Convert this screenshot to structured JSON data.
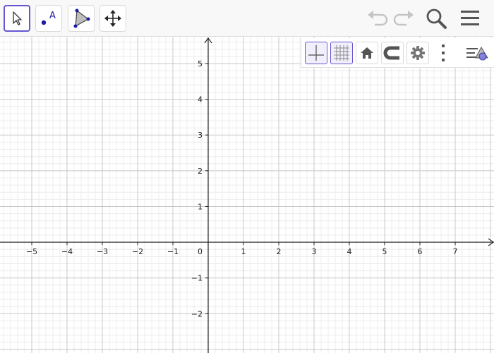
{
  "colors": {
    "accent": "#6557d2",
    "axis": "#222222",
    "grid_major": "#c8c8c8",
    "grid_minor": "#ececec",
    "icon": "#555555",
    "icon_disabled": "#c4c4c4",
    "point": "#1a1aa8"
  },
  "toolbar": {
    "tools": [
      {
        "name": "move-tool",
        "icon": "cursor-arrow-icon",
        "active": true
      },
      {
        "name": "point-tool",
        "icon": "point-icon",
        "label": "A",
        "active": false
      },
      {
        "name": "polygon-tool",
        "icon": "polygon-icon",
        "active": false
      },
      {
        "name": "move-graphics-view-tool",
        "icon": "move-arrows-icon",
        "active": false
      }
    ],
    "right": [
      "undo-icon",
      "redo-icon",
      "search-icon",
      "menu-icon"
    ]
  },
  "style_bar": {
    "buttons": [
      {
        "name": "show-axes",
        "icon": "axes-icon",
        "selected": true
      },
      {
        "name": "show-grid",
        "icon": "grid-icon",
        "selected": true
      },
      {
        "name": "standard-view",
        "icon": "home-icon",
        "selected": false
      },
      {
        "name": "point-capturing",
        "icon": "magnet-icon",
        "selected": false
      },
      {
        "name": "settings",
        "icon": "gear-icon",
        "selected": false
      },
      {
        "name": "more",
        "icon": "more-vertical-icon",
        "selected": false
      },
      {
        "name": "toggle-style-bar",
        "icon": "style-bar-toggle-icon",
        "selected": false
      }
    ]
  },
  "graph": {
    "x_range": [
      -5.9,
      8.1
    ],
    "y_range": [
      -3.1,
      5.75
    ],
    "x_ticks": [
      "−5",
      "−4",
      "−3",
      "−2",
      "−1",
      "1",
      "2",
      "3",
      "4",
      "5",
      "6",
      "7"
    ],
    "y_ticks": [
      "−2",
      "−1",
      "1",
      "2",
      "3",
      "4",
      "5"
    ],
    "origin_label": "0",
    "grid": true,
    "minor_divisions": 5
  }
}
